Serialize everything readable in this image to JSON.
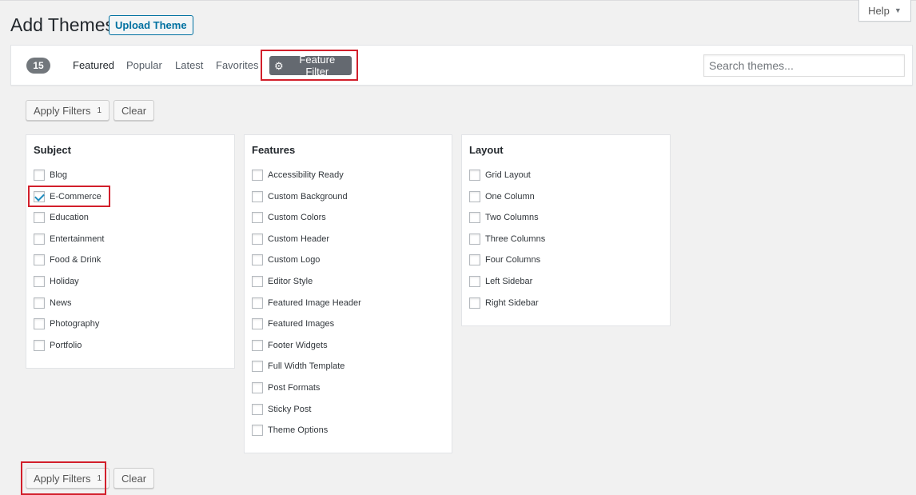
{
  "help": {
    "label": "Help",
    "caret": "▼"
  },
  "header": {
    "title": "Add Themes",
    "upload_label": "Upload Theme"
  },
  "filter_bar": {
    "count": "15",
    "tabs": [
      "Featured",
      "Popular",
      "Latest",
      "Favorites"
    ],
    "feature_filter_label": "Feature Filter",
    "search_placeholder": "Search themes..."
  },
  "actions": {
    "apply_label": "Apply Filters",
    "apply_count": "1",
    "clear_label": "Clear"
  },
  "groups": {
    "subject": {
      "title": "Subject",
      "items": [
        {
          "label": "Blog",
          "checked": false
        },
        {
          "label": "E-Commerce",
          "checked": true
        },
        {
          "label": "Education",
          "checked": false
        },
        {
          "label": "Entertainment",
          "checked": false
        },
        {
          "label": "Food & Drink",
          "checked": false
        },
        {
          "label": "Holiday",
          "checked": false
        },
        {
          "label": "News",
          "checked": false
        },
        {
          "label": "Photography",
          "checked": false
        },
        {
          "label": "Portfolio",
          "checked": false
        }
      ]
    },
    "features": {
      "title": "Features",
      "items": [
        {
          "label": "Accessibility Ready",
          "checked": false
        },
        {
          "label": "Custom Background",
          "checked": false
        },
        {
          "label": "Custom Colors",
          "checked": false
        },
        {
          "label": "Custom Header",
          "checked": false
        },
        {
          "label": "Custom Logo",
          "checked": false
        },
        {
          "label": "Editor Style",
          "checked": false
        },
        {
          "label": "Featured Image Header",
          "checked": false
        },
        {
          "label": "Featured Images",
          "checked": false
        },
        {
          "label": "Footer Widgets",
          "checked": false
        },
        {
          "label": "Full Width Template",
          "checked": false
        },
        {
          "label": "Post Formats",
          "checked": false
        },
        {
          "label": "Sticky Post",
          "checked": false
        },
        {
          "label": "Theme Options",
          "checked": false
        }
      ]
    },
    "layout": {
      "title": "Layout",
      "items": [
        {
          "label": "Grid Layout",
          "checked": false
        },
        {
          "label": "One Column",
          "checked": false
        },
        {
          "label": "Two Columns",
          "checked": false
        },
        {
          "label": "Three Columns",
          "checked": false
        },
        {
          "label": "Four Columns",
          "checked": false
        },
        {
          "label": "Left Sidebar",
          "checked": false
        },
        {
          "label": "Right Sidebar",
          "checked": false
        }
      ]
    }
  },
  "colors": {
    "highlight": "#d21f2b",
    "link": "#0071a1",
    "check": "#1e8cbe"
  }
}
